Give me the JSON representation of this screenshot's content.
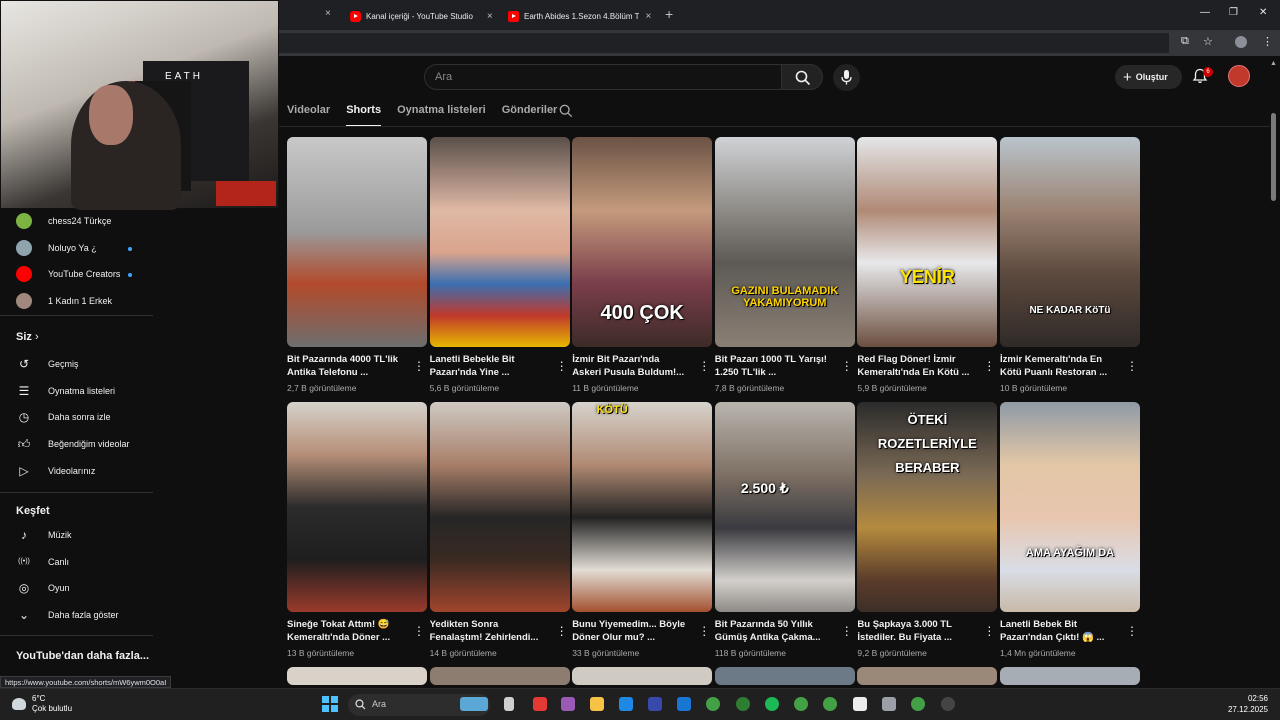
{
  "browser": {
    "tabs": [
      {
        "label": "Kanal içeriği - YouTube Studio"
      },
      {
        "label": "Earth Abides 1.Sezon 4.Bölüm T"
      }
    ],
    "new_tab_label": "+",
    "close_label": "×",
    "window_controls": [
      "—",
      "❐",
      "✕"
    ],
    "status_url": "https://www.youtube.com/shorts/mW6ywm0O0aI"
  },
  "header": {
    "search_placeholder": "Ara",
    "create_label": "Oluştur",
    "notification_count": "6"
  },
  "channel_tabs": {
    "items": [
      "Videolar",
      "Shorts",
      "Oynatma listeleri",
      "Gönderiler"
    ],
    "active_index": 1
  },
  "sidebar": {
    "subscriptions": [
      {
        "label": "chess24 Türkçe",
        "color": "#7cb342",
        "live": false
      },
      {
        "label": "Noluyo Ya ¿",
        "color": "#90a4ae",
        "live": true
      },
      {
        "label": "YouTube Creators",
        "color": "#ff0000",
        "live": true
      },
      {
        "label": "1 Kadın 1 Erkek",
        "color": "#a1887f",
        "live": false
      }
    ],
    "you_heading": "Siz",
    "you_items": [
      "Geçmiş",
      "Oynatma listeleri",
      "Daha sonra izle",
      "Beğendiğim videolar",
      "Videolarınız"
    ],
    "explore_heading": "Keşfet",
    "explore_items": [
      "Müzik",
      "Canlı",
      "Oyun",
      "Daha fazla göster"
    ],
    "more_heading": "YouTube'dan daha fazla..."
  },
  "shorts": [
    {
      "title": "Bit Pazarında 4000 TL'lik Antika Telefonu ...",
      "views": "2,7 B görüntüleme",
      "overlay": "",
      "bg": "linear-gradient(180deg,#c9c9c9 0%,#9a9a9a 45%,#b24a2b 70%,#6e6e6e 100%)"
    },
    {
      "title": "Lanetli Bebekle Bit Pazarı'nda Yine ...",
      "views": "5,6 B görüntüleme",
      "overlay": "",
      "bg": "linear-gradient(180deg,#5a4f4a 0%,#e0b9a5 35%,#d9a48d 55%,#3c6fb0 70%,#c0392b 85%,#e6b800 100%)"
    },
    {
      "title": "İzmir Bit Pazarı'nda Askeri Pusula Buldum!...",
      "views": "11 B görüntüleme",
      "overlay": "400 ÇOK",
      "bg": "linear-gradient(180deg,#6b5345 0%,#c49a7c 35%,#7a3e4a 70%,#3d2b28 100%)"
    },
    {
      "title": "Bit Pazarı 1000 TL Yarışı! 1.250 TL'lik ...",
      "views": "7,8 B görüntüleme",
      "overlay": "GAZINI BULAMADIK YAKAMIYORUM",
      "bg": "linear-gradient(180deg,#cfd2d6 0%,#8e8b86 35%,#5d5a55 60%,#8a7f74 100%)"
    },
    {
      "title": "Red Flag Döner! İzmir Kemeraltı'nda En Kötü ...",
      "views": "5,9 B görüntüleme",
      "overlay": "YENİR",
      "bg": "linear-gradient(180deg,#e4e6e8 0%,#b08a76 35%,#e8e8ea 60%,#6b4f3f 100%)"
    },
    {
      "title": "İzmir Kemeraltı'nda En Kötü Puanlı Restoran ...",
      "views": "10 B görüntüleme",
      "overlay": "NE KADAR KöTü",
      "bg": "linear-gradient(180deg,#b9c4cc 0%,#9b8373 35%,#5d4a3e 65%,#2f2a27 100%)"
    },
    {
      "title": "Sineğe Tokat Attım! 😅 Kemeraltı'nda Döner ...",
      "views": "13 B görüntüleme",
      "overlay": "",
      "bg": "linear-gradient(180deg,#d6d2cc 0%,#b58e77 25%,#2b2b2b 50%,#1e1e1e 75%,#9a3b2c 100%)"
    },
    {
      "title": "Yedikten Sonra Fenalaştım! Zehirlendi...",
      "views": "14 B görüntüleme",
      "overlay": "",
      "bg": "linear-gradient(180deg,#cfcac3 0%,#a77e68 30%,#262626 55%,#3a2a22 75%,#a1452d 100%)"
    },
    {
      "title": "Bunu Yiyemedim... Böyle Döner Olur mu? ...",
      "views": "33 B görüntüleme",
      "overlay": "KÖTÜ",
      "bg": "linear-gradient(180deg,#d7d3cd 0%,#b08a73 30%,#232323 55%,#e2ddd5 80%,#a3502f 100%)"
    },
    {
      "title": "Bit Pazarında 50 Yıllık Gümüş Antika Çakma...",
      "views": "118 B görüntüleme",
      "overlay": "2.500 ₺",
      "bg": "linear-gradient(180deg,#b9b5ae 0%,#7d6f63 35%,#3a3a40 60%,#d3d0cc 85%,#8d8a86 100%)"
    },
    {
      "title": "Bu Şapkaya 3.000 TL İstediler. Bu Fiyata ...",
      "views": "9,2 B görüntüleme",
      "overlay": "ÖTEKİ ROZETLERİYLE BERABER",
      "bg": "linear-gradient(180deg,#2b2b2b 0%,#7b6a55 35%,#b48a3e 60%,#5a3c2a 85%,#3d2f27 100%)"
    },
    {
      "title": "Lanetli Bebek Bit Pazarı'ndan Çıktı! 😱 ...",
      "views": "1,4 Mn görüntüleme",
      "overlay": "AMA AYAĞIM DA",
      "bg": "linear-gradient(180deg,#8f9aa6 0%,#e3c7a6 30%,#e8c6b0 55%,#d9dde6 80%,#c9b9a8 100%)"
    }
  ],
  "taskbar": {
    "weather_temp": "6°C",
    "weather_desc": "Çok bulutlu",
    "search_placeholder": "Ara",
    "time": "02:56",
    "date": "27.12.2025"
  }
}
